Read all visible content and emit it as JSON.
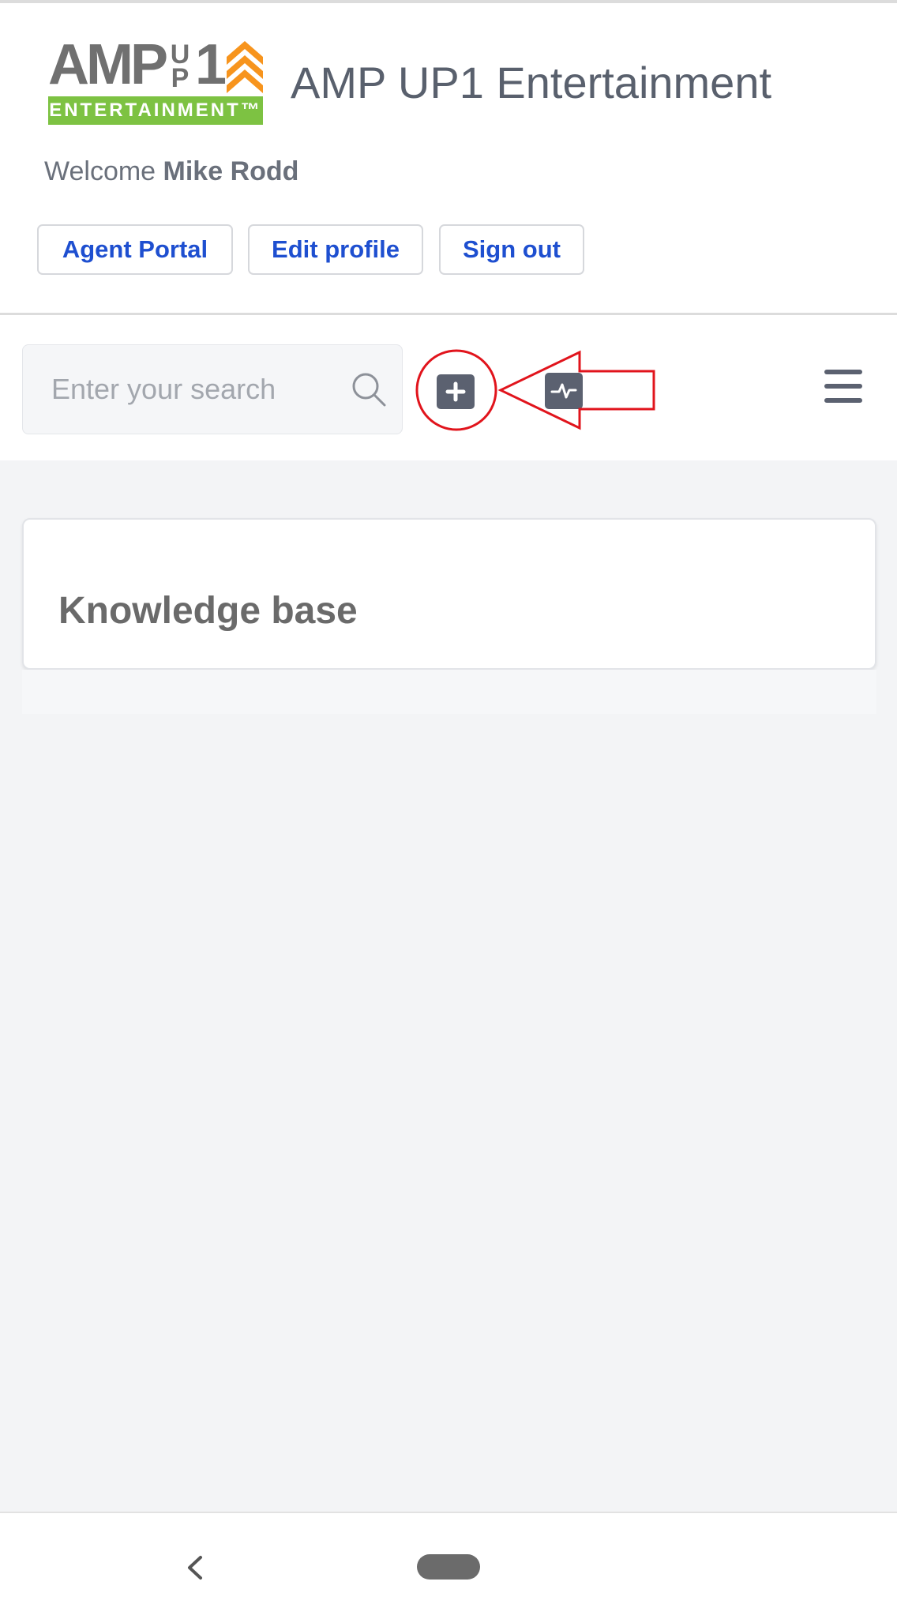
{
  "logo": {
    "top_text": "AMP",
    "up_letters": [
      "U",
      "P"
    ],
    "number": "1",
    "bottom_text": "ENTERTAINMENT™"
  },
  "header": {
    "site_title": "AMP UP1 Entertainment",
    "welcome_prefix": "Welcome ",
    "user_name": "Mike Rodd",
    "buttons": {
      "agent_portal": "Agent Portal",
      "edit_profile": "Edit profile",
      "sign_out": "Sign out"
    }
  },
  "toolbar": {
    "search_placeholder": "Enter your search",
    "icons": [
      "search-icon",
      "plus-square-icon",
      "activity-icon",
      "hamburger-menu-icon"
    ]
  },
  "main": {
    "card_title": "Knowledge base"
  },
  "android_nav": {
    "icons": [
      "back-chevron-icon",
      "home-pill-icon"
    ]
  },
  "colors": {
    "link_blue": "#1e4fd0",
    "icon_gray": "#5b6170",
    "logo_green": "#7dc242",
    "logo_orange": "#f7941d",
    "annotation_red": "#e1141c"
  }
}
